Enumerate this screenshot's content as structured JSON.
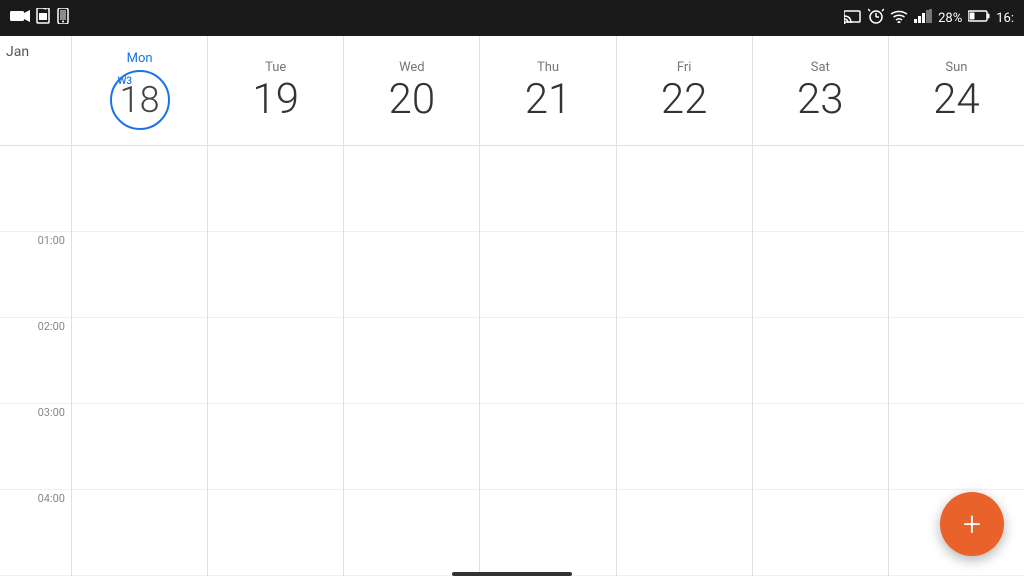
{
  "statusBar": {
    "left": {
      "icons": [
        "camera-icon",
        "sim-icon",
        "phone-icon"
      ]
    },
    "right": {
      "cast": "cast-icon",
      "alarm": "alarm-icon",
      "wifi": "wifi-icon",
      "signal": "signal-icon",
      "battery": "28%",
      "time": "16:"
    }
  },
  "calendar": {
    "monthLabel": "Jan",
    "weekLabel": "W3",
    "days": [
      {
        "id": "jan",
        "name": "Jan",
        "number": "",
        "isMonthLabel": true
      },
      {
        "id": "mon18",
        "name": "Mon",
        "number": "18",
        "isToday": true
      },
      {
        "id": "tue19",
        "name": "Tue",
        "number": "19",
        "isToday": false
      },
      {
        "id": "wed20",
        "name": "Wed",
        "number": "20",
        "isToday": false
      },
      {
        "id": "thu21",
        "name": "Thu",
        "number": "21",
        "isToday": false
      },
      {
        "id": "fri22",
        "name": "Fri",
        "number": "22",
        "isToday": false
      },
      {
        "id": "sat23",
        "name": "Sat",
        "number": "23",
        "isToday": false
      },
      {
        "id": "sun24",
        "name": "Sun",
        "number": "24",
        "isToday": false
      }
    ],
    "timeSlots": [
      "01:00",
      "02:00",
      "03:00",
      "04:00"
    ],
    "fab": {
      "label": "+"
    }
  }
}
